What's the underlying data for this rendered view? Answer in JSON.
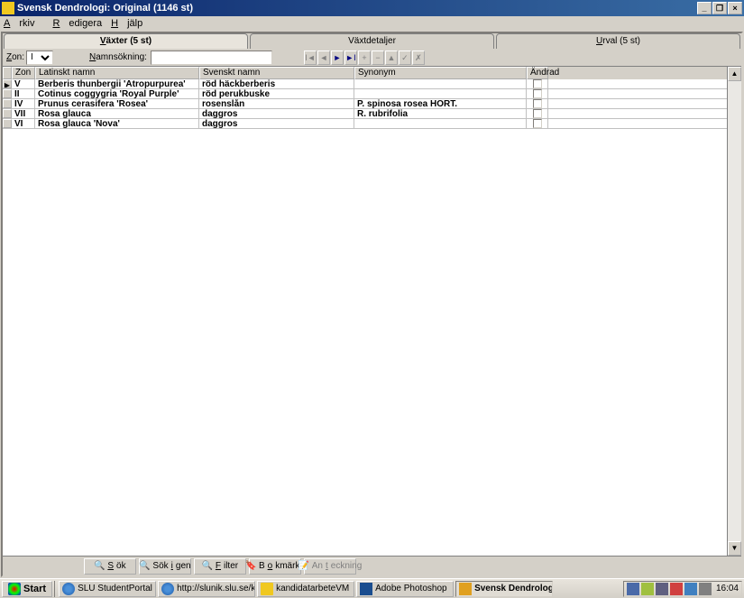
{
  "titlebar": {
    "title": "Svensk Dendrologi: Original (1146 st)"
  },
  "menubar": {
    "arkiv": "Arkiv",
    "redigera": "Redigera",
    "hjalp": "Hjälp"
  },
  "tabs": {
    "vaxter": "Växter (5 st)",
    "vaxtdetaljer": "Växtdetaljer",
    "urval": "Urval (5 st)"
  },
  "filter": {
    "zon_label": "Zon:",
    "zon_value": "I",
    "namn_label": "Namnsökning:",
    "namn_value": ""
  },
  "grid": {
    "headers": {
      "zon": "Zon",
      "latinskt": "Latinskt namn",
      "svenskt": "Svenskt namn",
      "synonym": "Synonym",
      "andrad": "Ändrad"
    },
    "rows": [
      {
        "zon": "V",
        "latin": "Berberis thunbergii 'Atropurpurea'",
        "svenskt": "röd häckberberis",
        "synonym": "",
        "current": true
      },
      {
        "zon": "II",
        "latin": "Cotinus coggygria 'Royal Purple'",
        "svenskt": "röd perukbuske",
        "synonym": "",
        "current": false
      },
      {
        "zon": "IV",
        "latin": "Prunus cerasifera 'Rosea'",
        "svenskt": "rosenslån",
        "synonym": "P. spinosa rosea HORT.",
        "current": false
      },
      {
        "zon": "VII",
        "latin": "Rosa glauca",
        "svenskt": "daggros",
        "synonym": "R. rubrifolia",
        "current": false
      },
      {
        "zon": "VI",
        "latin": "Rosa glauca 'Nova'",
        "svenskt": "daggros",
        "synonym": "",
        "current": false
      }
    ]
  },
  "buttons": {
    "sok": "Sök",
    "sokigen": "Sök igen",
    "filter": "Filter",
    "bokmarke": "Bokmärke",
    "anteckning": "Anteckning"
  },
  "taskbar": {
    "start": "Start",
    "tasks": [
      "SLU StudentPortal - Micr...",
      "http://slunik.slu.se/kursfi...",
      "kandidatarbeteVM",
      "Adobe Photoshop",
      "Svensk Dendrologi: O..."
    ],
    "clock": "16:04"
  }
}
